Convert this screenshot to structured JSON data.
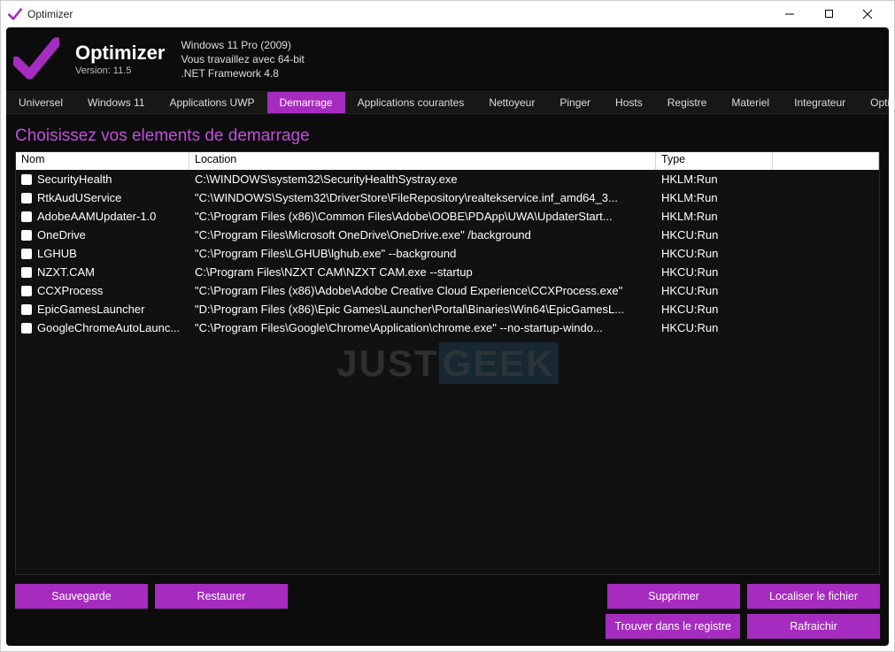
{
  "window": {
    "title": "Optimizer"
  },
  "header": {
    "app_name": "Optimizer",
    "version": "Version: 11.5",
    "sys_line1": "Windows 11 Pro (2009)",
    "sys_line2": "Vous travaillez avec 64-bit",
    "sys_line3": ".NET Framework 4.8"
  },
  "tabs": [
    {
      "label": "Universel",
      "active": false
    },
    {
      "label": "Windows 11",
      "active": false
    },
    {
      "label": "Applications UWP",
      "active": false
    },
    {
      "label": "Demarrage",
      "active": true
    },
    {
      "label": "Applications courantes",
      "active": false
    },
    {
      "label": "Nettoyeur",
      "active": false
    },
    {
      "label": "Pinger",
      "active": false
    },
    {
      "label": "Hosts",
      "active": false
    },
    {
      "label": "Registre",
      "active": false
    },
    {
      "label": "Materiel",
      "active": false
    },
    {
      "label": "Integrateur",
      "active": false
    },
    {
      "label": "Options",
      "active": false
    }
  ],
  "section_title": "Choisissez vos elements de demarrage",
  "columns": {
    "name": "Nom",
    "location": "Location",
    "type": "Type"
  },
  "rows": [
    {
      "name": "SecurityHealth",
      "location": "C:\\WINDOWS\\system32\\SecurityHealthSystray.exe",
      "type": "HKLM:Run"
    },
    {
      "name": "RtkAudUService",
      "location": "\"C:\\WINDOWS\\System32\\DriverStore\\FileRepository\\realtekservice.inf_amd64_3...",
      "type": "HKLM:Run"
    },
    {
      "name": "AdobeAAMUpdater-1.0",
      "location": "\"C:\\Program Files (x86)\\Common Files\\Adobe\\OOBE\\PDApp\\UWA\\UpdaterStart...",
      "type": "HKLM:Run"
    },
    {
      "name": "OneDrive",
      "location": "\"C:\\Program Files\\Microsoft OneDrive\\OneDrive.exe\" /background",
      "type": "HKCU:Run"
    },
    {
      "name": "LGHUB",
      "location": "\"C:\\Program Files\\LGHUB\\lghub.exe\" --background",
      "type": "HKCU:Run"
    },
    {
      "name": "NZXT.CAM",
      "location": "C:\\Program Files\\NZXT CAM\\NZXT CAM.exe --startup",
      "type": "HKCU:Run"
    },
    {
      "name": "CCXProcess",
      "location": "\"C:\\Program Files (x86)\\Adobe\\Adobe Creative Cloud Experience\\CCXProcess.exe\"",
      "type": "HKCU:Run"
    },
    {
      "name": "EpicGamesLauncher",
      "location": "\"D:\\Program Files (x86)\\Epic Games\\Launcher\\Portal\\Binaries\\Win64\\EpicGamesL...",
      "type": "HKCU:Run"
    },
    {
      "name": "GoogleChromeAutoLaunc...",
      "location": "\"C:\\Program Files\\Google\\Chrome\\Application\\chrome.exe\" --no-startup-windo...",
      "type": "HKCU:Run"
    }
  ],
  "buttons": {
    "save": "Sauvegarde",
    "restore": "Restaurer",
    "delete": "Supprimer",
    "locate": "Localiser le fichier",
    "find_registry": "Trouver dans le registre",
    "refresh": "Rafraichir"
  },
  "watermark": {
    "part1": "JUST",
    "part2": "GEEK"
  },
  "colors": {
    "accent": "#a62bbf",
    "bg_dark": "#0c0c0c"
  }
}
